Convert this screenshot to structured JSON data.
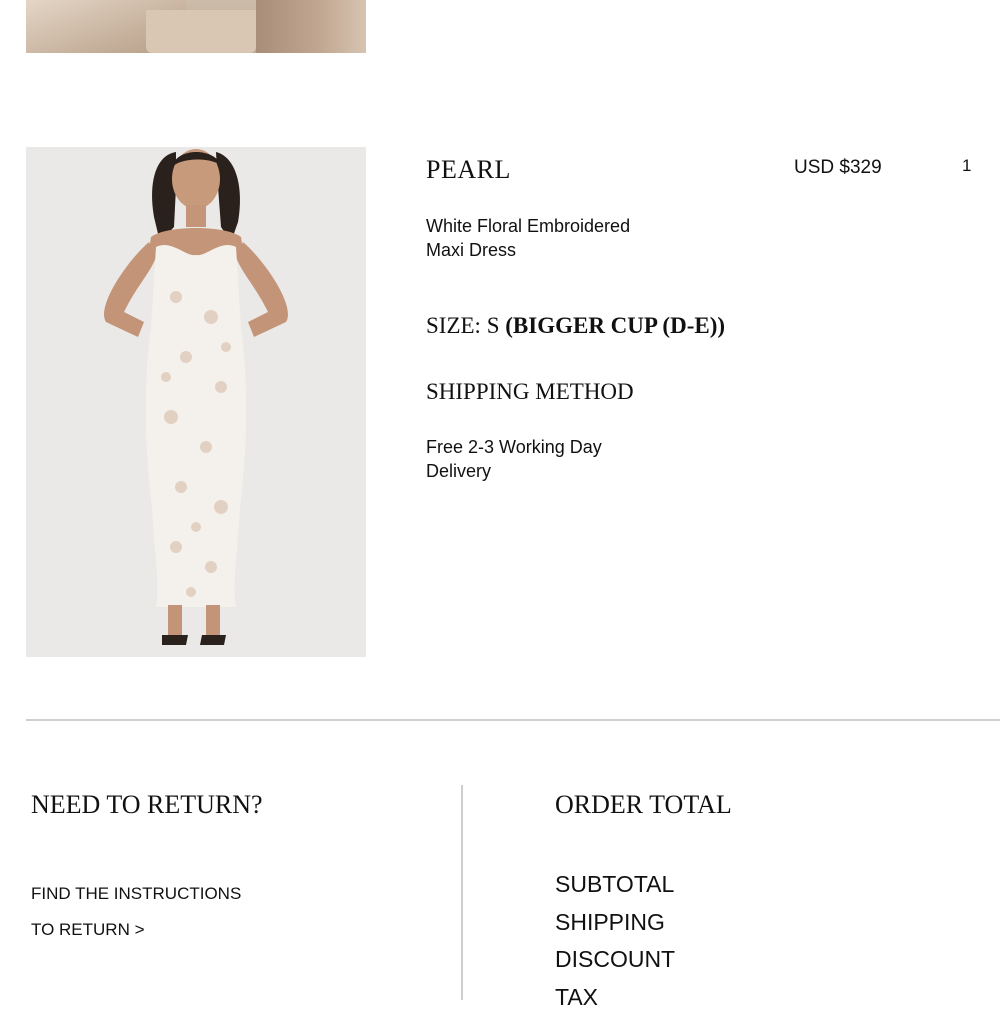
{
  "product": {
    "name": "PEARL",
    "price": "USD $329",
    "quantity": "1",
    "description": "White Floral Embroidered Maxi Dress",
    "size_label": "SIZE:",
    "size_value": "S",
    "size_variant": "(BIGGER CUP (D-E))",
    "shipping_title": "SHIPPING METHOD",
    "shipping_value": "Free 2-3 Working Day Delivery"
  },
  "returns": {
    "title": "NEED TO RETURN?",
    "link_line1": "FIND THE INSTRUCTIONS",
    "link_line2": "TO RETURN >"
  },
  "order_total": {
    "title": "ORDER TOTAL",
    "rows": [
      "SUBTOTAL",
      "SHIPPING",
      "DISCOUNT",
      "TAX"
    ]
  }
}
